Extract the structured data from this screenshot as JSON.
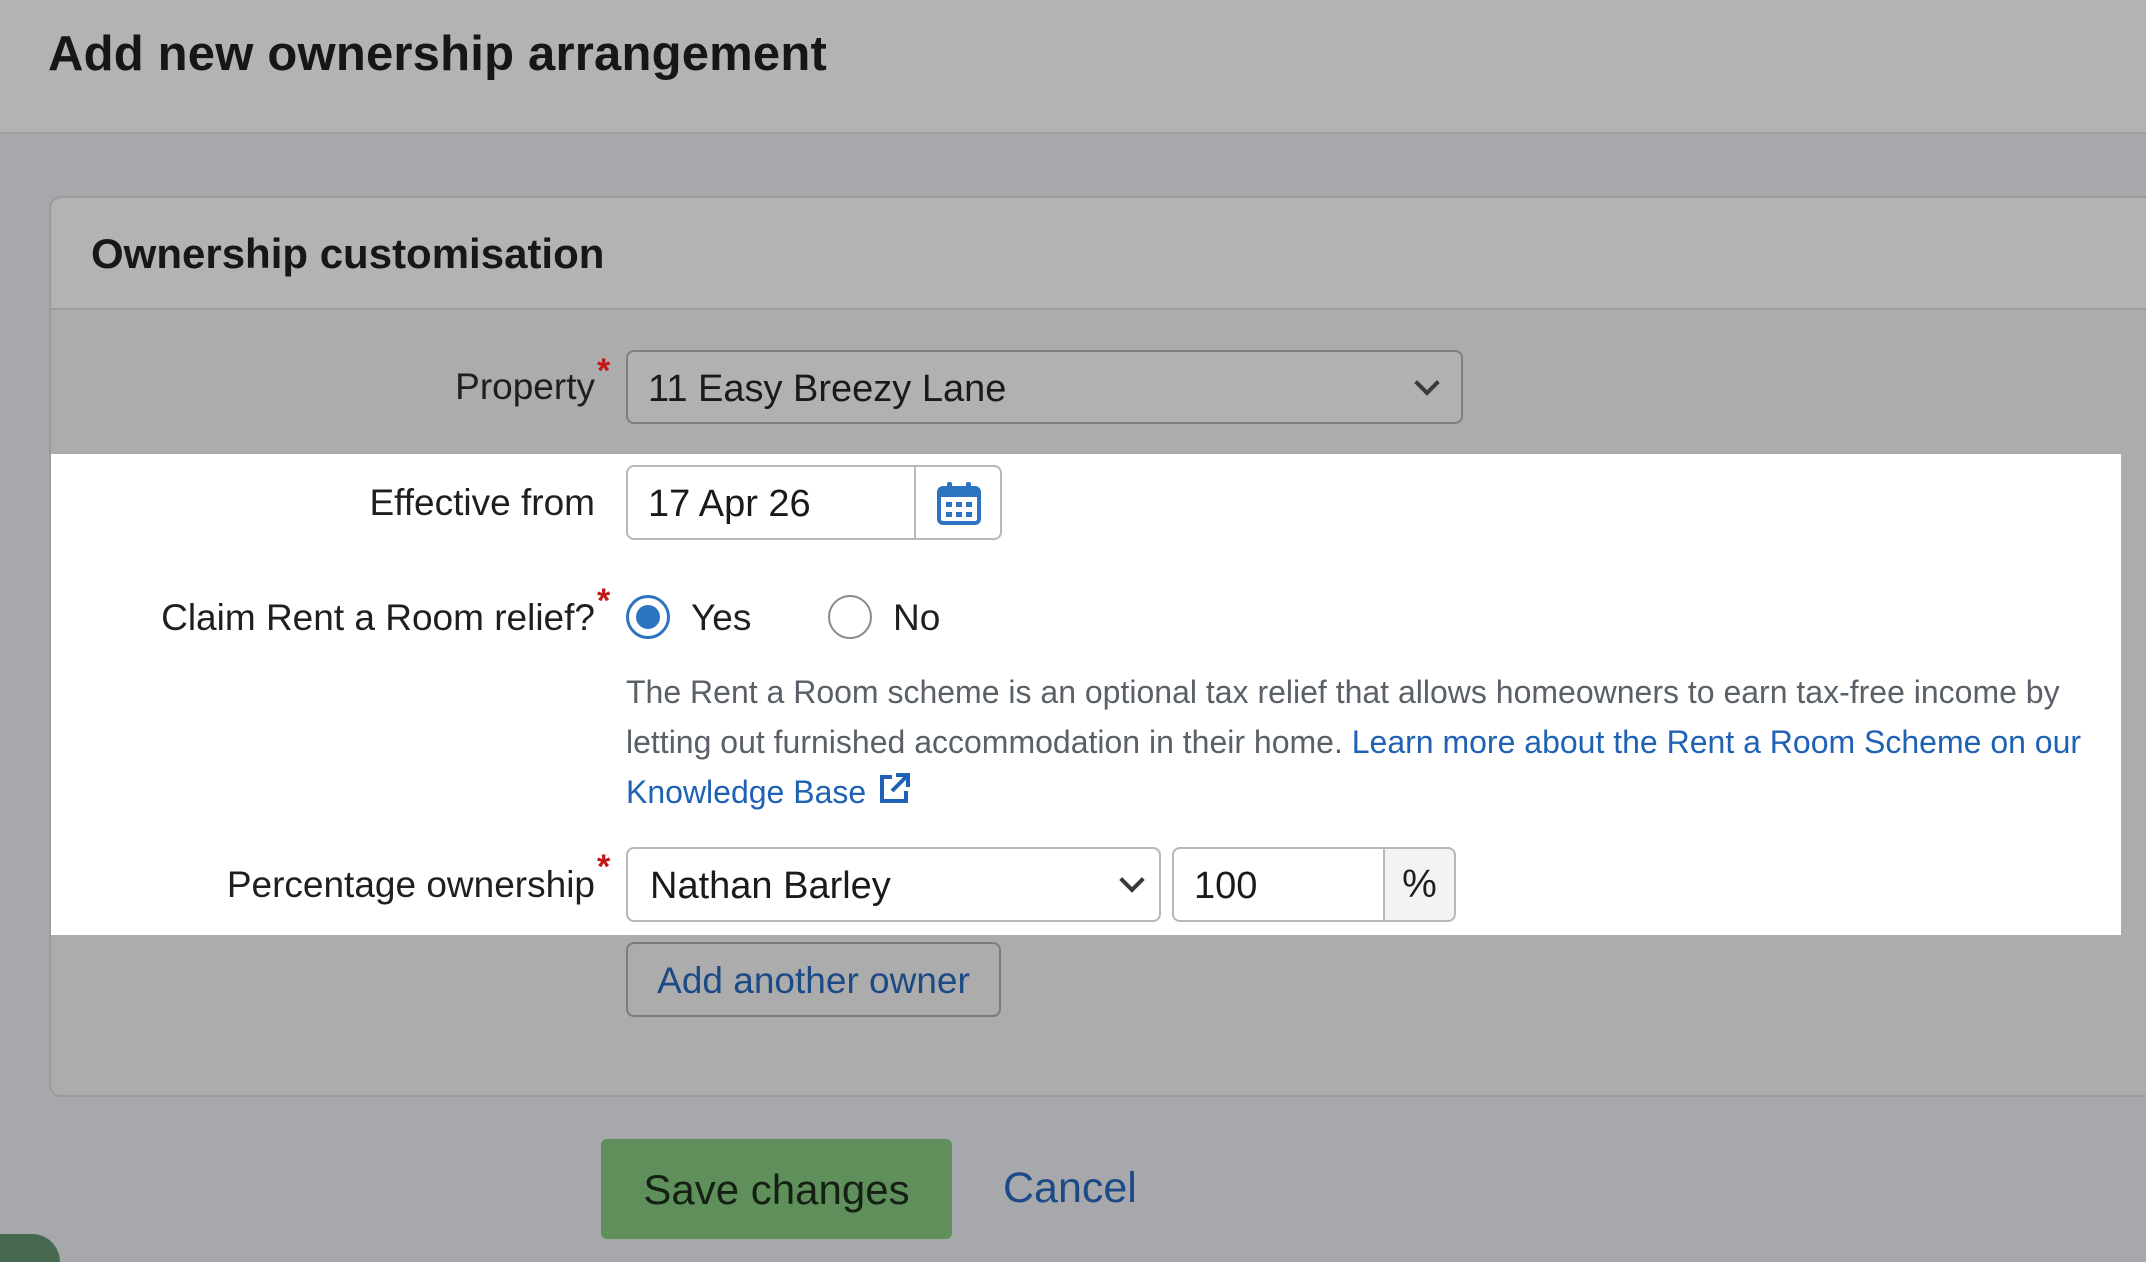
{
  "page": {
    "title": "Add new ownership arrangement"
  },
  "panel": {
    "title": "Ownership customisation"
  },
  "form": {
    "property": {
      "label": "Property",
      "required_mark": "*",
      "value": "11 Easy Breezy Lane"
    },
    "effective_from": {
      "label": "Effective from",
      "value": "17 Apr 26",
      "icon": "calendar-icon"
    },
    "rent_a_room": {
      "label": "Claim Rent a Room relief?",
      "required_mark": "*",
      "options": [
        {
          "label": "Yes",
          "selected": true
        },
        {
          "label": "No",
          "selected": false
        }
      ],
      "help_text": "The Rent a Room scheme is an optional tax relief that allows homeowners to earn tax-free income by letting out furnished accommodation in their home.",
      "help_link": "Learn more about the Rent a Room Scheme on our Knowledge Base",
      "help_link_icon": "external-link-icon"
    },
    "percentage_ownership": {
      "label": "Percentage ownership",
      "required_mark": "*",
      "owner": "Nathan Barley",
      "percent": "100",
      "unit": "%"
    },
    "add_owner_label": "Add another owner"
  },
  "actions": {
    "save_label": "Save changes",
    "cancel_label": "Cancel"
  },
  "colors": {
    "accent_blue": "#2d74c0",
    "link_blue": "#1f62b5",
    "required_red": "#c01818",
    "save_green": "#5f8f5b"
  }
}
